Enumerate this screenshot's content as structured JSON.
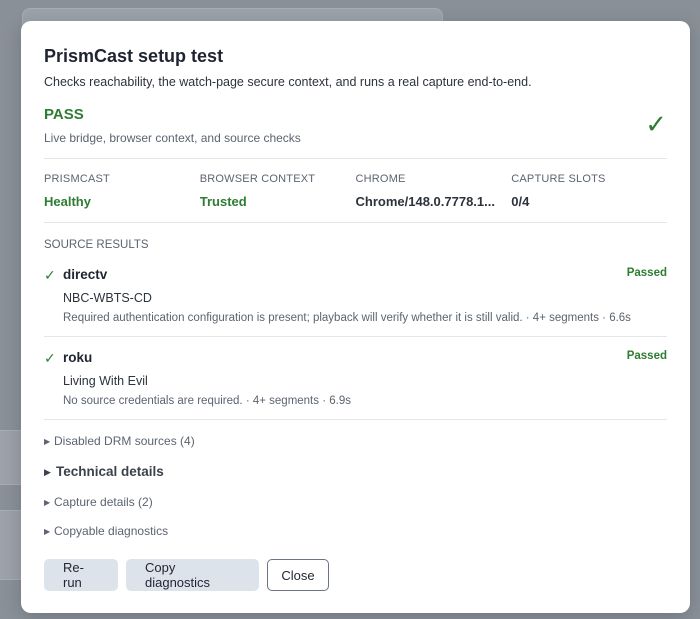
{
  "modal": {
    "title": "PrismCast setup test",
    "subtitle": "Checks reachability, the watch-page secure context, and runs a real capture end-to-end."
  },
  "status": {
    "label": "PASS",
    "description": "Live bridge, browser context, and source checks",
    "icon": "check-icon",
    "color": "#2e7d32"
  },
  "metrics": [
    {
      "label": "PRISMCAST",
      "value": "Healthy"
    },
    {
      "label": "BROWSER CONTEXT",
      "value": "Trusted"
    },
    {
      "label": "CHROME",
      "value": "Chrome/148.0.7778.1..."
    },
    {
      "label": "CAPTURE SLOTS",
      "value": "0/4"
    }
  ],
  "sources": {
    "label": "SOURCE RESULTS",
    "items": [
      {
        "name": "directv",
        "status": "Passed",
        "channel": "NBC-WBTS-CD",
        "detail": "Required authentication configuration is present; playback will verify whether it is still valid. · 4+ segments · 6.6s"
      },
      {
        "name": "roku",
        "status": "Passed",
        "channel": "Living With Evil",
        "detail": "No source credentials are required. · 4+ segments · 6.9s"
      }
    ]
  },
  "disclosures": {
    "disabled_drm": "Disabled DRM sources (4)",
    "technical": "Technical details",
    "capture": "Capture details (2)",
    "copyable": "Copyable diagnostics"
  },
  "buttons": {
    "rerun": "Re-run",
    "copy": "Copy diagnostics",
    "close": "Close"
  }
}
